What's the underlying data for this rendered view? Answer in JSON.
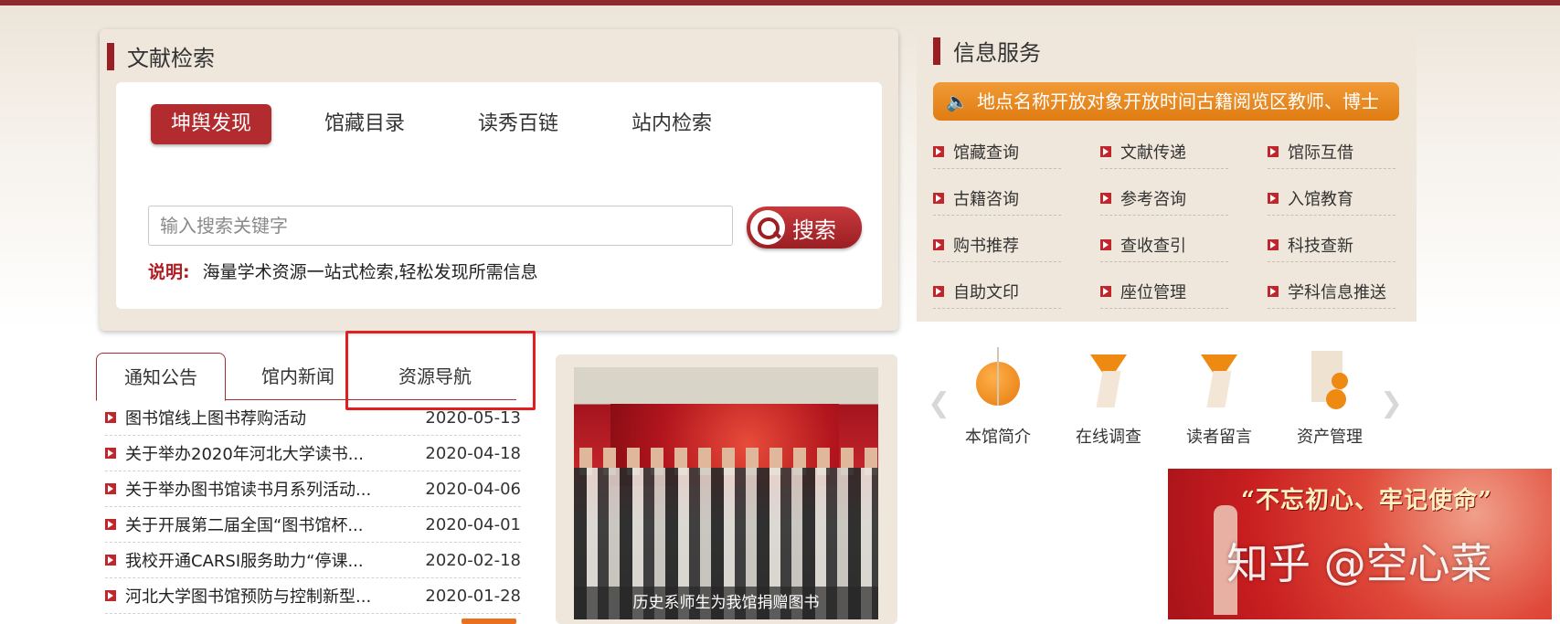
{
  "search": {
    "title": "文献检索",
    "tabs": [
      "坤舆发现",
      "馆藏目录",
      "读秀百链",
      "站内检索"
    ],
    "placeholder": "输入搜索关键字",
    "button_label": "搜索",
    "note_label": "说明:",
    "note_text": "海量学术资源一站式检索,轻松发现所需信息"
  },
  "info": {
    "title": "信息服务",
    "notice": "地点名称开放对象开放时间古籍阅览区教师、博士",
    "services": [
      "馆藏查询",
      "文献传递",
      "馆际互借",
      "古籍咨询",
      "参考咨询",
      "入馆教育",
      "购书推荐",
      "查收查引",
      "科技查新",
      "自助文印",
      "座位管理",
      "学科信息推送"
    ]
  },
  "news": {
    "tabs": [
      "通知公告",
      "馆内新闻",
      "资源导航"
    ],
    "items": [
      {
        "title": "图书馆线上图书荐购活动",
        "date": "2020-05-13"
      },
      {
        "title": "关于举办2020年河北大学读书...",
        "date": "2020-04-18"
      },
      {
        "title": "关于举办图书馆读书月系列活动...",
        "date": "2020-04-06"
      },
      {
        "title": "关于开展第二届全国“图书馆杯...",
        "date": "2020-04-01"
      },
      {
        "title": "我校开通CARSI服务助力“停课...",
        "date": "2020-02-18"
      },
      {
        "title": "河北大学图书馆预防与控制新型...",
        "date": "2020-01-28"
      }
    ]
  },
  "photo": {
    "caption": "历史系师生为我馆捐赠图书"
  },
  "quick_links": [
    {
      "label": "本馆简介",
      "icon": "intro-icon"
    },
    {
      "label": "在线调查",
      "icon": "survey-icon"
    },
    {
      "label": "读者留言",
      "icon": "message-icon"
    },
    {
      "label": "资产管理",
      "icon": "asset-icon"
    }
  ],
  "banner": {
    "slogan": "“不忘初心、牢记使命”",
    "watermark": "知乎 @空心菜"
  },
  "colors": {
    "brand_red": "#b22b2f",
    "accent_orange": "#e8801a",
    "panel_bg": "#efe7dc"
  }
}
